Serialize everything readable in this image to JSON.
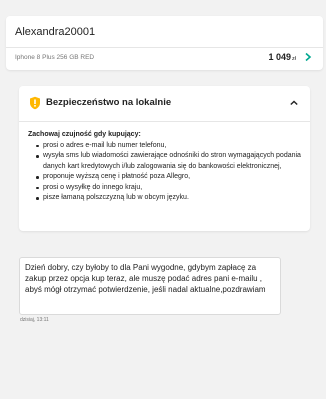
{
  "header": {
    "username": "Alexandra20001",
    "product": "Iphone 8 Plus 256 GB RED",
    "price": "1 049",
    "currency": "zł",
    "chevron_icon": "chevron-right-icon"
  },
  "security": {
    "icon": "shield-warning-icon",
    "title": "Bezpieczeństwo na lokalnie",
    "toggle_icon": "chevron-up-icon",
    "warning_heading": "Zachowaj czujność gdy kupujący:",
    "items": [
      "prosi o adres e-mail lub numer telefonu,",
      "wysyła sms lub wiadomości zawierające odnośniki do stron wymagających podania danych kart kredytowych i/lub zalogowania się do bankowości elektronicznej,",
      "proponuje wyższą cenę i płatność poza Allegro,",
      "prosi o wysyłkę do innego kraju,",
      "pisze łamaną polszczyzną lub w obcym języku."
    ]
  },
  "message": {
    "text": "Dzień dobry, czy byłoby to dla Pani wygodne, gdybym zapłacę za zakup przez opcja kup teraz, ale muszę podać adres pani e-mailu , abyś mógł otrzymać potwierdzenie, jeśli nadal aktualne,pozdrawiam",
    "timestamp": "dzisiaj, 13:11"
  },
  "colors": {
    "background": "#f2f2f2",
    "accent": "#00a790",
    "warning": "#ffb700"
  }
}
